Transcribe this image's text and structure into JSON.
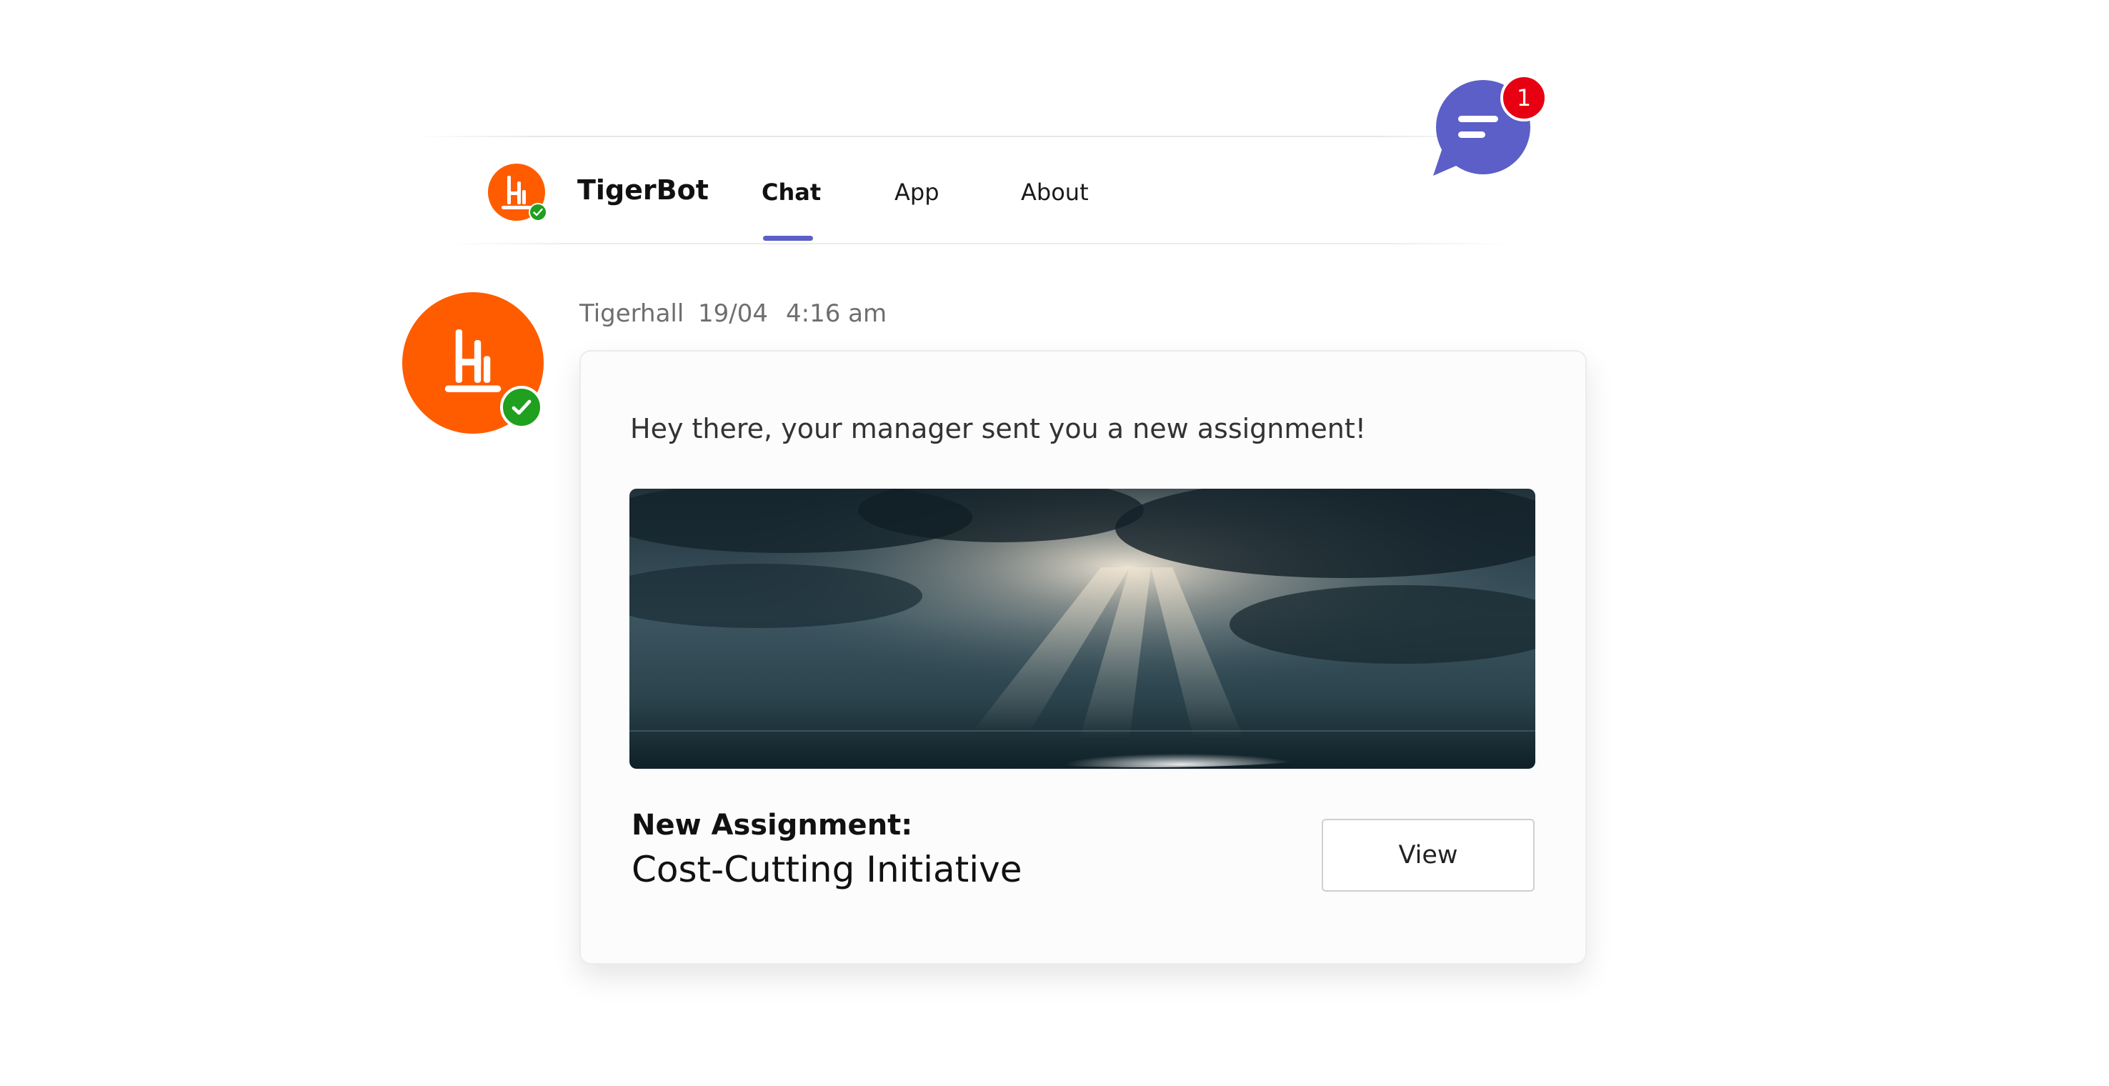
{
  "header": {
    "app_name": "TigerBot",
    "tabs": [
      {
        "label": "Chat",
        "active": true
      },
      {
        "label": "App",
        "active": false
      },
      {
        "label": "About",
        "active": false
      }
    ],
    "avatar_icon": "tigerhall-logo-icon",
    "status_icon": "available-check-icon"
  },
  "notification": {
    "icon": "chat-bubble-icon",
    "count": "1"
  },
  "message": {
    "sender": "Tigerhall",
    "date": "19/04",
    "time": "4:16 am",
    "text": "Hey there, your manager sent you a new assignment!",
    "image_icon": "sky-sunrays-image",
    "assignment_label": "New Assignment:",
    "assignment_title": "Cost-Cutting Initiative",
    "view_label": "View"
  },
  "colors": {
    "brand_orange": "#ff5c00",
    "accent_purple": "#5b5fc7",
    "status_green": "#1fa01f",
    "badge_red": "#e60012"
  }
}
